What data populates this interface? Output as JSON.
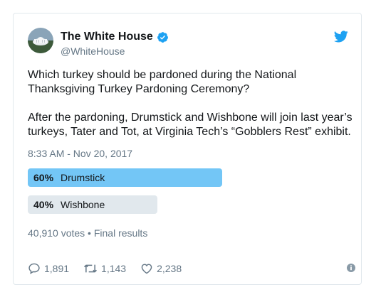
{
  "account": {
    "display_name": "The White House",
    "handle": "@WhiteHouse"
  },
  "tweet": {
    "paragraphs": [
      "Which turkey should be pardoned during the National Thanksgiving Turkey Pardoning Ceremony?",
      "After the pardoning, Drumstick and Wishbone will join last year’s turkeys, Tater and Tot, at Virginia Tech’s “Gobblers Rest” exhibit."
    ],
    "timestamp": "8:33 AM - Nov 20, 2017"
  },
  "poll": {
    "choices": [
      {
        "percent_label": "60%",
        "label": "Drumstick",
        "percent": 60,
        "winner": true
      },
      {
        "percent_label": "40%",
        "label": "Wishbone",
        "percent": 40,
        "winner": false
      }
    ],
    "summary": "40,910 votes • Final results"
  },
  "actions": {
    "replies": "1,891",
    "retweets": "1,143",
    "likes": "2,238"
  },
  "icons": {
    "verified": "verified-badge-icon",
    "bird": "twitter-bird-icon",
    "reply": "reply-icon",
    "retweet": "retweet-icon",
    "like": "heart-icon",
    "info": "info-icon"
  },
  "colors": {
    "twitter_blue": "#1da1f2",
    "winner_bar": "#73c6f6",
    "loser_bar": "#e1e8ed",
    "muted_text": "#657786"
  }
}
